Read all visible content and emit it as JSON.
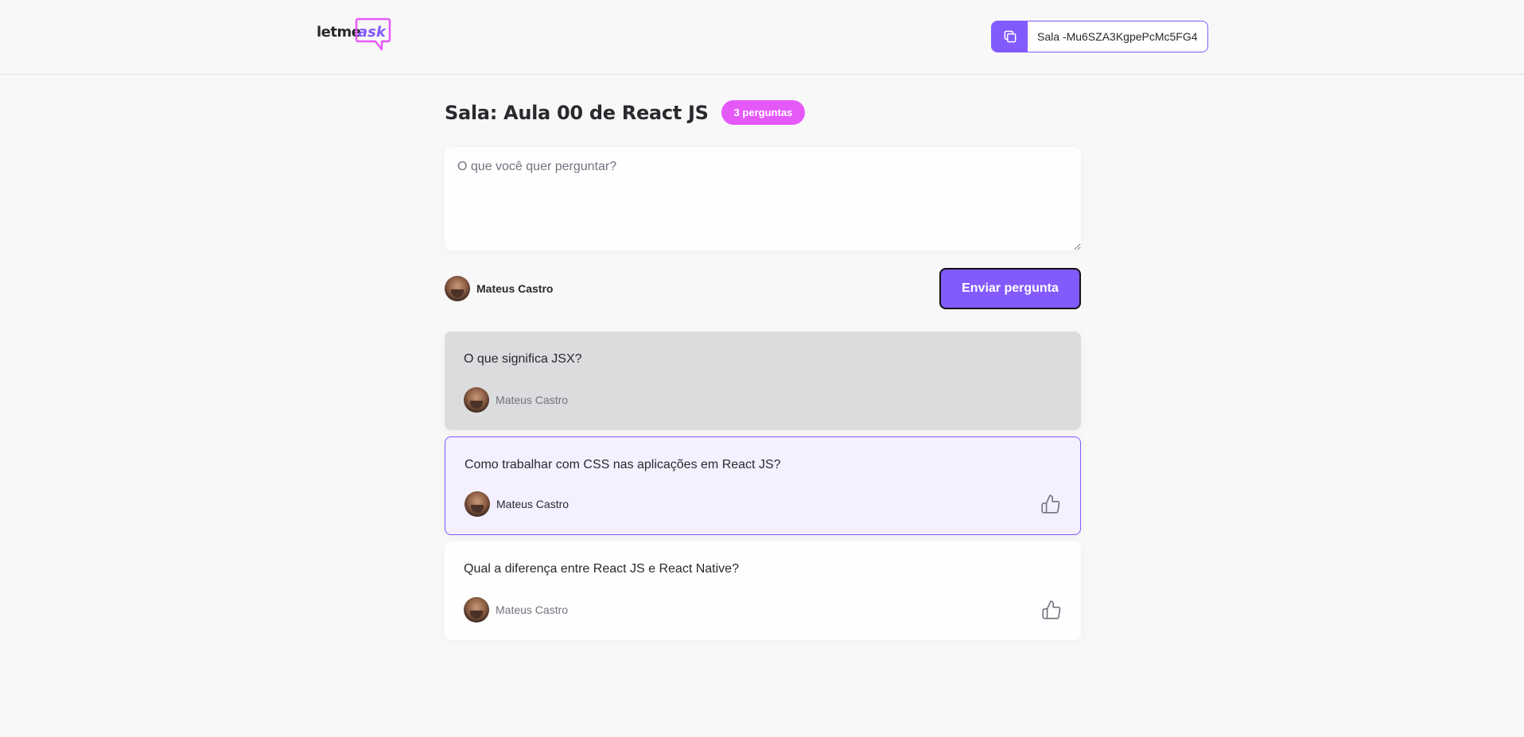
{
  "header": {
    "logo": {
      "text_left": "letme",
      "text_right": "ask"
    },
    "room_code": {
      "label": "Sala -Mu6SZA3KgpePcMc5FG4",
      "icon": "copy-icon"
    }
  },
  "room": {
    "title": "Sala: Aula 00 de React JS",
    "count_badge": "3 perguntas"
  },
  "form": {
    "placeholder": "O que você quer perguntar?",
    "value": "",
    "user_name": "Mateus Castro",
    "submit_label": "Enviar pergunta"
  },
  "questions": [
    {
      "content": "O que significa JSX?",
      "author": "Mateus Castro",
      "state": "answered"
    },
    {
      "content": "Como trabalhar com CSS nas aplicações em React JS?",
      "author": "Mateus Castro",
      "state": "highlighted",
      "like_icon": "thumbs-up-icon"
    },
    {
      "content": "Qual a diferença entre React JS e React Native?",
      "author": "Mateus Castro",
      "state": "default",
      "like_icon": "thumbs-up-icon"
    }
  ],
  "colors": {
    "accent": "#835afd",
    "badge": "#e559f9",
    "background": "#f8f8f8",
    "answered_bg": "#dbdcdd",
    "highlighted_bg": "#f4f0ff",
    "text": "#29292e",
    "muted_text": "#737380"
  }
}
